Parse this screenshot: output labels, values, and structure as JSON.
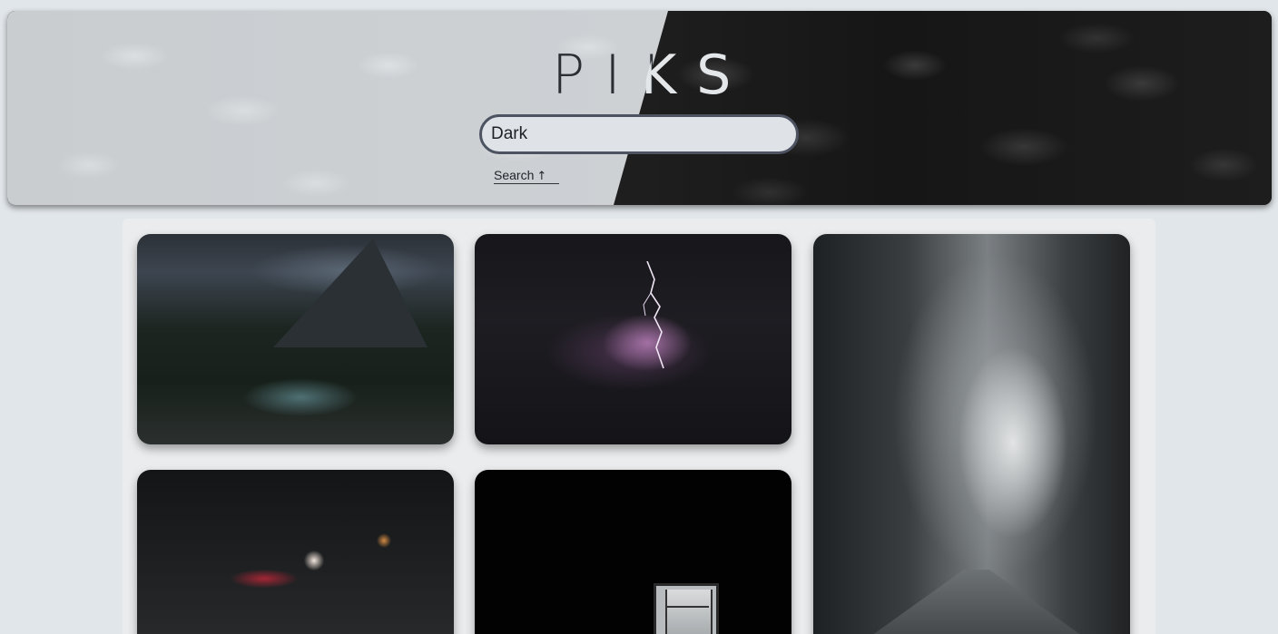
{
  "header": {
    "logo": "PIKS",
    "search": {
      "value": "Dark",
      "placeholder": ""
    },
    "search_button_label": "Search",
    "search_button_icon": "arrow-up-icon"
  },
  "gallery": {
    "images": [
      {
        "name": "forest-river-image"
      },
      {
        "name": "lightning-cloud-image"
      },
      {
        "name": "foggy-road-image"
      },
      {
        "name": "dark-tunnel-image"
      },
      {
        "name": "dark-window-image"
      }
    ]
  },
  "colors": {
    "background": "#e1e6ea",
    "input_border": "#4d5361",
    "logo": "#2b2f33"
  }
}
